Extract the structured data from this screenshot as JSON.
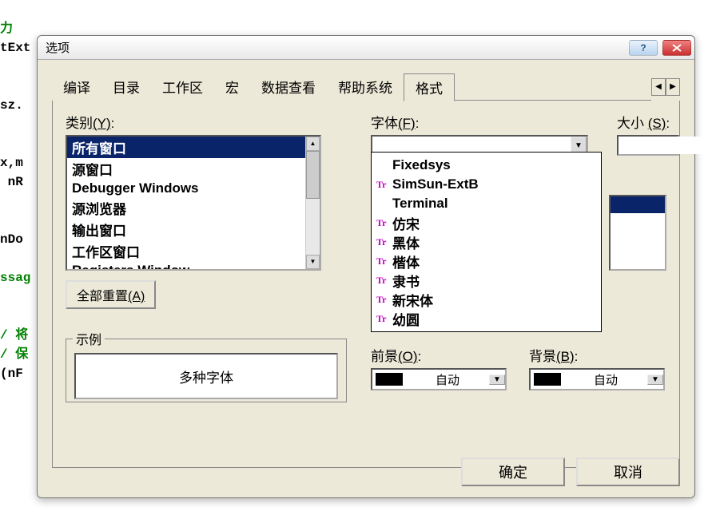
{
  "bg_code": {
    "l1": "力",
    "l2": "tExt",
    "l3": "sz.",
    "l4": "x,m",
    "l5": " nR",
    "l6": "nDo",
    "l7": "ssag",
    "l8a": "/ 将",
    "l8b": "/ 保",
    "l9": "(nF"
  },
  "dialog": {
    "title": "选项",
    "tabs": [
      "编译",
      "目录",
      "工作区",
      "宏",
      "数据查看",
      "帮助系统",
      "格式"
    ],
    "active_tab": 6,
    "category": {
      "label": "类别",
      "hotkey": "(Y)",
      "items": [
        "所有窗口",
        "源窗口",
        "Debugger Windows",
        "源浏览器",
        "输出窗口",
        "工作区窗口",
        "Registers Window"
      ],
      "selected": 0,
      "reset_all": "全部重置",
      "reset_hotkey": "(A)"
    },
    "font": {
      "label": "字体",
      "hotkey": "(F)",
      "value": "",
      "options": [
        {
          "name": "Fixedsys",
          "tt": false
        },
        {
          "name": "SimSun-ExtB",
          "tt": true
        },
        {
          "name": "Terminal",
          "tt": false
        },
        {
          "name": "仿宋",
          "tt": true
        },
        {
          "name": "黑体",
          "tt": true
        },
        {
          "name": "楷体",
          "tt": true
        },
        {
          "name": "隶书",
          "tt": true
        },
        {
          "name": "新宋体",
          "tt": true
        },
        {
          "name": "幼圆",
          "tt": true
        }
      ]
    },
    "size": {
      "label": "大小",
      "hotkey": "(S)",
      "value": ""
    },
    "style_selected": 0,
    "sample": {
      "legend": "示例",
      "text": "多种字体"
    },
    "foreground": {
      "label": "前景",
      "hotkey": "(O)",
      "value": "自动"
    },
    "background": {
      "label": "背景",
      "hotkey": "(B)",
      "value": "自动"
    },
    "ok": "确定",
    "cancel": "取消"
  }
}
